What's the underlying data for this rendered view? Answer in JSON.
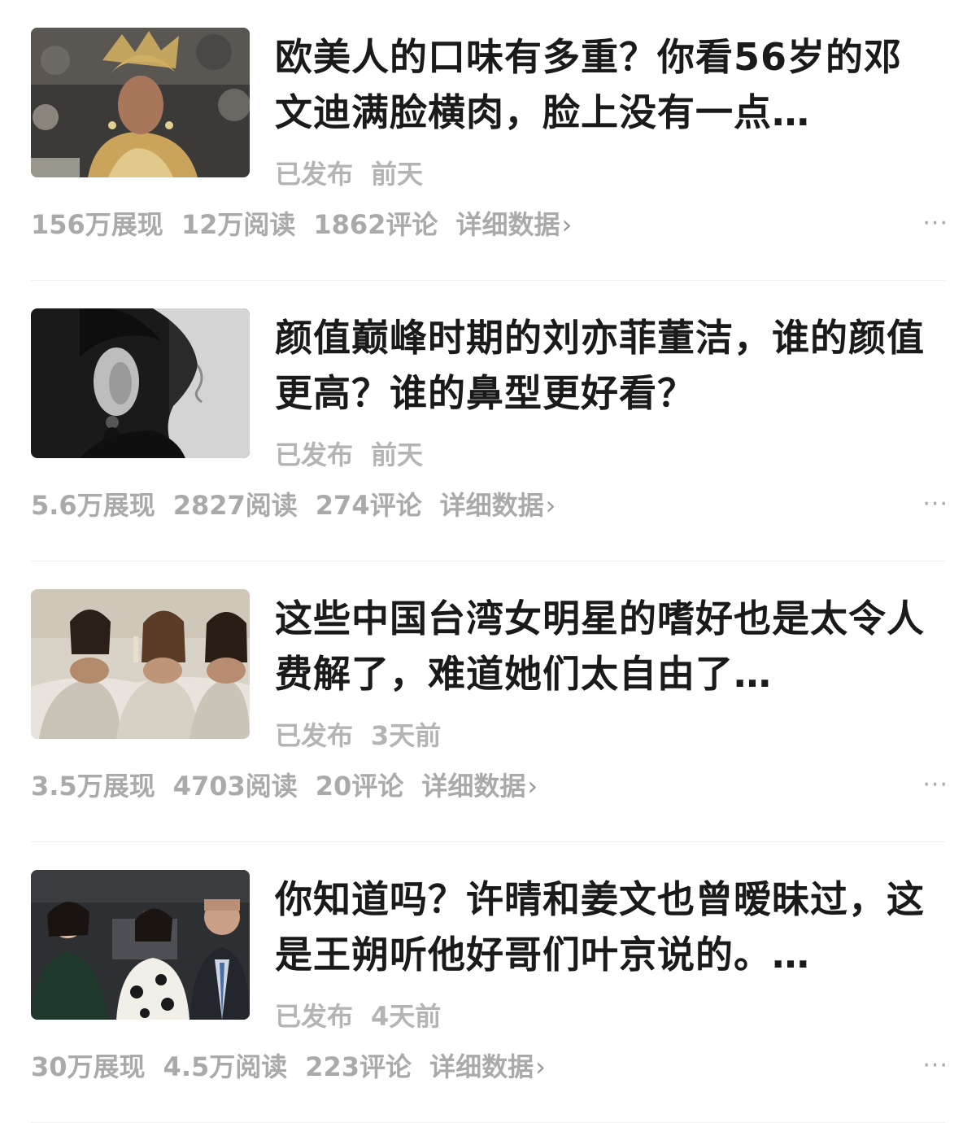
{
  "articles": [
    {
      "title": "欧美人的口味有多重？你看56岁的邓文迪满脸横肉，脸上没有一点…",
      "status": "已发布",
      "time": "前天",
      "impressions": "156万展现",
      "reads": "12万阅读",
      "comments": "1862评论",
      "detail": "详细数据",
      "more": "···"
    },
    {
      "title": "颜值巅峰时期的刘亦菲董洁，谁的颜值更高？谁的鼻型更好看？",
      "status": "已发布",
      "time": "前天",
      "impressions": "5.6万展现",
      "reads": "2827阅读",
      "comments": "274评论",
      "detail": "详细数据",
      "more": "···"
    },
    {
      "title": "这些中国台湾女明星的嗜好也是太令人费解了，难道她们太自由了…",
      "status": "已发布",
      "time": "3天前",
      "impressions": "3.5万展现",
      "reads": "4703阅读",
      "comments": "20评论",
      "detail": "详细数据",
      "more": "···"
    },
    {
      "title": "你知道吗？许晴和姜文也曾暧昧过，这是王朔听他好哥们叶京说的。…",
      "status": "已发布",
      "time": "4天前",
      "impressions": "30万展现",
      "reads": "4.5万阅读",
      "comments": "223评论",
      "detail": "详细数据",
      "more": "···"
    }
  ],
  "icons": {
    "chevron": "›"
  }
}
